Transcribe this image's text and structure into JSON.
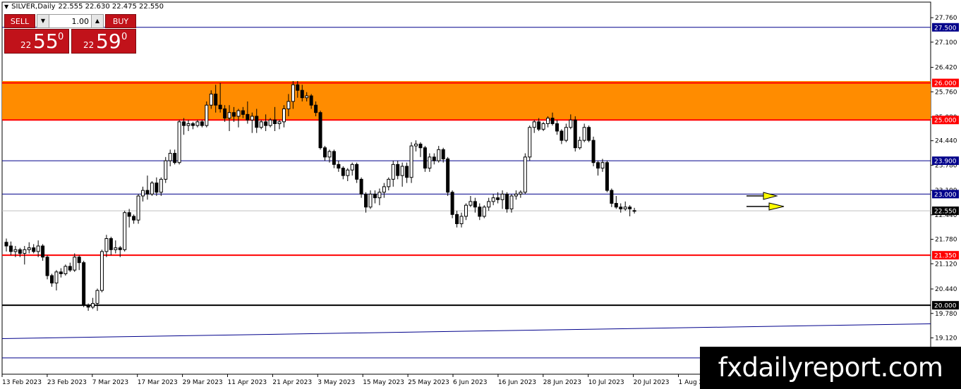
{
  "header": {
    "symbol": "SILVER,Daily",
    "ohlc": "22.555 22.630 22.475 22.550"
  },
  "trade_panel": {
    "sell_label": "SELL",
    "buy_label": "BUY",
    "lot_value": "1.00",
    "sell_price": {
      "prefix": "22",
      "big": "55",
      "sup": "0"
    },
    "buy_price": {
      "prefix": "22",
      "big": "59",
      "sup": "0"
    }
  },
  "watermark": "fxdailyreport.com",
  "colors": {
    "zone_fill": "#ff8c00",
    "resistance_red": "#ff0000",
    "blue_line": "#00008b",
    "black_line": "#000000",
    "bull_candle": "#ffffff",
    "bear_candle": "#000000",
    "arrow_yellow": "#ffff00",
    "current_price_line": "#c0c0c0"
  },
  "chart_data": {
    "type": "candlestick",
    "title": "SILVER,Daily",
    "ylim": [
      18.14,
      28.18
    ],
    "y_ticks": [
      "27.760",
      "27.100",
      "26.420",
      "25.760",
      "25.080",
      "24.440",
      "23.780",
      "23.100",
      "22.440",
      "21.780",
      "21.120",
      "20.440",
      "19.780",
      "19.120"
    ],
    "x_ticks": [
      "13 Feb 2023",
      "23 Feb 2023",
      "7 Mar 2023",
      "17 Mar 2023",
      "29 Mar 2023",
      "11 Apr 2023",
      "21 Apr 2023",
      "3 May 2023",
      "15 May 2023",
      "25 May 2023",
      "6 Jun 2023",
      "16 Jun 2023",
      "28 Jun 2023",
      "10 Jul 2023",
      "20 Jul 2023",
      "1 Aug 2023"
    ],
    "horizontal_levels": [
      {
        "value": 27.5,
        "label": "27.500",
        "style": "blue"
      },
      {
        "value": 26.0,
        "label": "26.000",
        "style": "red"
      },
      {
        "value": 25.0,
        "label": "25.000",
        "style": "red"
      },
      {
        "value": 23.9,
        "label": "23.900",
        "style": "blue"
      },
      {
        "value": 23.0,
        "label": "23.000",
        "style": "blue"
      },
      {
        "value": 22.55,
        "label": "22.550",
        "style": "current"
      },
      {
        "value": 21.35,
        "label": "21.350",
        "style": "red"
      },
      {
        "value": 20.0,
        "label": "20.000",
        "style": "black"
      },
      {
        "value": 18.58,
        "label": "18.580",
        "style": "blue"
      }
    ],
    "zone": {
      "from": 25.0,
      "to": 26.05
    },
    "trendline": {
      "start": 19.1,
      "end": 19.5
    },
    "candles": [
      [
        21.7,
        21.8,
        21.45,
        21.6
      ],
      [
        21.6,
        21.72,
        21.35,
        21.45
      ],
      [
        21.45,
        21.6,
        21.3,
        21.5
      ],
      [
        21.5,
        21.55,
        21.3,
        21.4
      ],
      [
        21.4,
        21.6,
        21.1,
        21.5
      ],
      [
        21.5,
        21.7,
        21.4,
        21.55
      ],
      [
        21.55,
        21.65,
        21.4,
        21.45
      ],
      [
        21.45,
        21.75,
        21.3,
        21.6
      ],
      [
        21.6,
        21.65,
        21.2,
        21.3
      ],
      [
        21.3,
        21.35,
        20.7,
        20.8
      ],
      [
        20.8,
        20.85,
        20.5,
        20.6
      ],
      [
        20.6,
        20.95,
        20.4,
        20.9
      ],
      [
        20.9,
        21.0,
        20.75,
        20.85
      ],
      [
        20.85,
        21.1,
        20.8,
        21.05
      ],
      [
        21.05,
        21.15,
        20.9,
        20.95
      ],
      [
        20.95,
        21.4,
        20.9,
        21.3
      ],
      [
        21.3,
        21.35,
        20.95,
        21.15
      ],
      [
        21.15,
        21.2,
        19.95,
        20.0
      ],
      [
        20.0,
        20.05,
        19.85,
        19.95
      ],
      [
        19.95,
        20.2,
        19.9,
        20.05
      ],
      [
        20.05,
        20.45,
        19.85,
        20.4
      ],
      [
        20.4,
        21.5,
        20.35,
        21.45
      ],
      [
        21.45,
        21.9,
        21.3,
        21.8
      ],
      [
        21.8,
        21.85,
        21.35,
        21.5
      ],
      [
        21.5,
        21.75,
        21.4,
        21.55
      ],
      [
        21.55,
        21.6,
        21.3,
        21.5
      ],
      [
        21.5,
        22.55,
        21.45,
        22.5
      ],
      [
        22.5,
        22.6,
        22.1,
        22.4
      ],
      [
        22.4,
        22.45,
        22.2,
        22.3
      ],
      [
        22.3,
        23.0,
        22.2,
        22.95
      ],
      [
        22.95,
        23.2,
        22.8,
        23.1
      ],
      [
        23.1,
        23.5,
        22.85,
        23.0
      ],
      [
        23.0,
        23.35,
        22.95,
        23.3
      ],
      [
        23.3,
        23.45,
        22.95,
        23.05
      ],
      [
        23.05,
        23.45,
        22.95,
        23.4
      ],
      [
        23.4,
        24.0,
        23.3,
        23.9
      ],
      [
        23.9,
        24.2,
        23.75,
        24.1
      ],
      [
        24.1,
        24.2,
        23.8,
        23.85
      ],
      [
        23.85,
        25.0,
        23.8,
        24.95
      ],
      [
        24.95,
        25.05,
        24.6,
        24.85
      ],
      [
        24.85,
        25.0,
        24.7,
        24.9
      ],
      [
        24.9,
        24.95,
        24.75,
        24.85
      ],
      [
        24.85,
        25.0,
        24.8,
        24.95
      ],
      [
        24.95,
        25.0,
        24.8,
        24.85
      ],
      [
        24.85,
        25.5,
        24.8,
        25.4
      ],
      [
        25.4,
        25.8,
        25.3,
        25.7
      ],
      [
        25.7,
        25.95,
        25.2,
        25.4
      ],
      [
        25.4,
        26.0,
        25.2,
        25.3
      ],
      [
        25.3,
        25.4,
        24.95,
        25.05
      ],
      [
        25.05,
        25.4,
        24.7,
        25.2
      ],
      [
        25.2,
        25.35,
        24.95,
        25.1
      ],
      [
        25.1,
        25.3,
        24.8,
        25.25
      ],
      [
        25.25,
        25.35,
        25.05,
        25.15
      ],
      [
        25.15,
        25.5,
        24.9,
        25.0
      ],
      [
        25.0,
        25.2,
        24.65,
        25.1
      ],
      [
        25.1,
        25.3,
        24.65,
        24.8
      ],
      [
        24.8,
        25.0,
        24.75,
        24.95
      ],
      [
        24.95,
        25.15,
        24.7,
        24.85
      ],
      [
        24.85,
        25.05,
        24.8,
        25.0
      ],
      [
        25.0,
        25.35,
        24.7,
        24.9
      ],
      [
        24.9,
        25.0,
        24.75,
        24.95
      ],
      [
        24.95,
        25.4,
        24.8,
        25.3
      ],
      [
        25.3,
        25.7,
        25.1,
        25.5
      ],
      [
        25.5,
        26.05,
        25.3,
        25.95
      ],
      [
        25.95,
        26.05,
        25.6,
        25.8
      ],
      [
        25.8,
        25.95,
        25.5,
        25.6
      ],
      [
        25.6,
        25.75,
        25.5,
        25.65
      ],
      [
        25.65,
        25.7,
        25.3,
        25.4
      ],
      [
        25.4,
        25.5,
        25.1,
        25.2
      ],
      [
        25.2,
        25.25,
        24.2,
        24.25
      ],
      [
        24.25,
        24.3,
        23.9,
        24.0
      ],
      [
        24.0,
        24.2,
        23.85,
        24.15
      ],
      [
        24.15,
        24.2,
        23.7,
        23.8
      ],
      [
        23.8,
        23.9,
        23.6,
        23.7
      ],
      [
        23.7,
        23.75,
        23.4,
        23.5
      ],
      [
        23.5,
        23.7,
        23.35,
        23.65
      ],
      [
        23.65,
        23.85,
        23.5,
        23.8
      ],
      [
        23.8,
        23.85,
        23.3,
        23.4
      ],
      [
        23.4,
        23.45,
        22.9,
        23.0
      ],
      [
        23.0,
        23.05,
        22.5,
        22.65
      ],
      [
        22.65,
        23.1,
        22.6,
        23.0
      ],
      [
        23.0,
        23.1,
        22.75,
        22.9
      ],
      [
        22.9,
        23.15,
        22.7,
        23.05
      ],
      [
        23.05,
        23.3,
        22.9,
        23.2
      ],
      [
        23.2,
        23.45,
        23.1,
        23.4
      ],
      [
        23.4,
        23.9,
        23.2,
        23.8
      ],
      [
        23.8,
        23.9,
        23.4,
        23.5
      ],
      [
        23.5,
        23.85,
        23.2,
        23.75
      ],
      [
        23.75,
        23.85,
        23.3,
        23.45
      ],
      [
        23.45,
        24.4,
        23.3,
        24.3
      ],
      [
        24.3,
        24.45,
        24.15,
        24.35
      ],
      [
        24.35,
        24.4,
        24.0,
        24.25
      ],
      [
        24.25,
        24.3,
        23.6,
        23.7
      ],
      [
        23.7,
        24.1,
        23.6,
        24.0
      ],
      [
        24.0,
        24.1,
        23.8,
        23.9
      ],
      [
        23.9,
        24.3,
        23.85,
        24.2
      ],
      [
        24.2,
        24.25,
        23.85,
        23.95
      ],
      [
        23.95,
        24.0,
        22.95,
        23.05
      ],
      [
        23.05,
        23.1,
        22.35,
        22.45
      ],
      [
        22.45,
        22.55,
        22.1,
        22.2
      ],
      [
        22.2,
        22.5,
        22.1,
        22.4
      ],
      [
        22.4,
        22.75,
        22.3,
        22.7
      ],
      [
        22.7,
        22.95,
        22.65,
        22.8
      ],
      [
        22.8,
        22.9,
        22.5,
        22.65
      ],
      [
        22.65,
        22.75,
        22.3,
        22.4
      ],
      [
        22.4,
        22.7,
        22.35,
        22.65
      ],
      [
        22.65,
        22.9,
        22.55,
        22.8
      ],
      [
        22.8,
        23.0,
        22.7,
        22.9
      ],
      [
        22.9,
        23.05,
        22.75,
        22.85
      ],
      [
        22.85,
        23.1,
        22.6,
        23.0
      ],
      [
        23.0,
        23.05,
        22.5,
        22.6
      ],
      [
        22.6,
        23.0,
        22.5,
        22.95
      ],
      [
        22.95,
        23.1,
        22.85,
        23.0
      ],
      [
        23.0,
        23.1,
        22.9,
        23.05
      ],
      [
        23.05,
        24.1,
        23.0,
        24.0
      ],
      [
        24.0,
        24.85,
        23.9,
        24.8
      ],
      [
        24.8,
        25.0,
        24.65,
        24.95
      ],
      [
        24.95,
        25.05,
        24.7,
        24.75
      ],
      [
        24.75,
        24.95,
        24.7,
        24.9
      ],
      [
        24.9,
        25.1,
        24.8,
        25.05
      ],
      [
        25.05,
        25.2,
        24.85,
        24.9
      ],
      [
        24.9,
        25.0,
        24.6,
        24.7
      ],
      [
        24.7,
        24.75,
        24.35,
        24.45
      ],
      [
        24.45,
        24.9,
        24.4,
        24.8
      ],
      [
        24.8,
        25.15,
        24.75,
        25.0
      ],
      [
        25.0,
        25.1,
        24.15,
        24.25
      ],
      [
        24.25,
        24.55,
        24.2,
        24.45
      ],
      [
        24.45,
        24.9,
        24.4,
        24.8
      ],
      [
        24.8,
        24.85,
        24.4,
        24.45
      ],
      [
        24.45,
        24.55,
        23.75,
        23.85
      ],
      [
        23.85,
        23.9,
        23.5,
        23.7
      ],
      [
        23.7,
        23.95,
        23.6,
        23.85
      ],
      [
        23.85,
        23.9,
        23.05,
        23.1
      ],
      [
        23.1,
        23.15,
        22.65,
        22.75
      ],
      [
        22.75,
        22.95,
        22.6,
        22.65
      ],
      [
        22.65,
        22.75,
        22.5,
        22.6
      ],
      [
        22.6,
        22.8,
        22.55,
        22.65
      ],
      [
        22.65,
        22.7,
        22.4,
        22.6
      ],
      [
        22.555,
        22.63,
        22.475,
        22.55
      ]
    ]
  }
}
